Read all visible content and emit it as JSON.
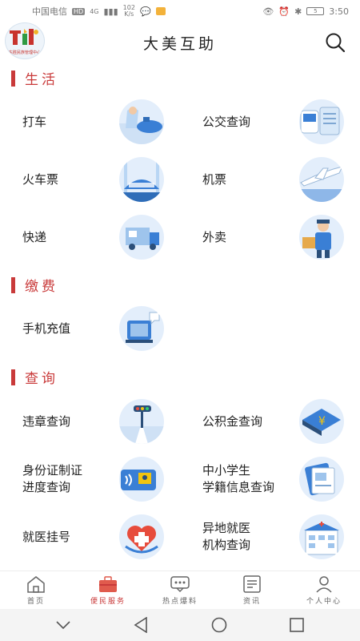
{
  "status_bar": {
    "carrier": "中国电信",
    "hd": "HD",
    "network": "4G",
    "speed": "102\nK/s",
    "battery": "5",
    "time": "3:50"
  },
  "header": {
    "title": "大美互助",
    "logo_text": "东胜民族管理中心"
  },
  "sections": [
    {
      "title": "生活",
      "items": [
        {
          "label": "打车",
          "icon": "taxi-icon"
        },
        {
          "label": "公交查询",
          "icon": "bus-icon"
        },
        {
          "label": "火车票",
          "icon": "train-icon"
        },
        {
          "label": "机票",
          "icon": "airplane-icon"
        },
        {
          "label": "快递",
          "icon": "delivery-truck-icon"
        },
        {
          "label": "外卖",
          "icon": "food-delivery-icon"
        }
      ]
    },
    {
      "title": "缴费",
      "items": [
        {
          "label": "手机充值",
          "icon": "phone-recharge-icon"
        }
      ]
    },
    {
      "title": "查询",
      "items": [
        {
          "label": "违章查询",
          "icon": "traffic-light-icon"
        },
        {
          "label": "公积金查询",
          "icon": "provident-fund-icon"
        },
        {
          "label": "身份证制证",
          "label2": "进度查询",
          "icon": "id-card-icon"
        },
        {
          "label": "中小学生",
          "label2": "学籍信息查询",
          "icon": "student-record-icon"
        },
        {
          "label": "就医挂号",
          "icon": "medical-heart-icon"
        },
        {
          "label": "异地就医",
          "label2": "机构查询",
          "icon": "hospital-icon"
        }
      ]
    }
  ],
  "bottom_nav": [
    {
      "label": "首页",
      "icon": "home-icon"
    },
    {
      "label": "便民服务",
      "icon": "toolbox-icon",
      "active": true
    },
    {
      "label": "热点爆料",
      "icon": "chat-bubble-icon"
    },
    {
      "label": "资讯",
      "icon": "news-icon"
    },
    {
      "label": "个人中心",
      "icon": "person-icon"
    }
  ],
  "colors": {
    "accent": "#c93a3a",
    "icon_bg": "#e3eefb",
    "icon_blue": "#3a7fd5"
  }
}
